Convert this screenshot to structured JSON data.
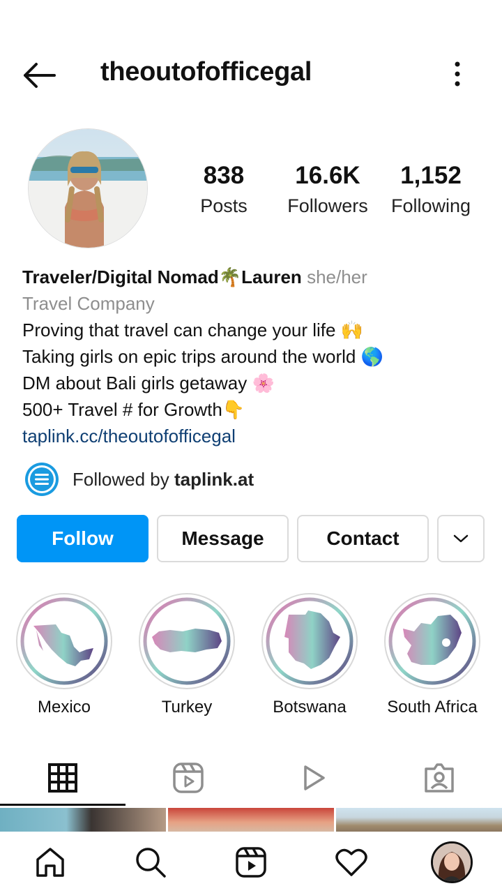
{
  "header": {
    "username": "theoutofofficegal",
    "back_icon": "arrow-left-icon",
    "more_icon": "more-vertical-icon"
  },
  "stats": [
    {
      "value": "838",
      "label": "Posts"
    },
    {
      "value": "16.6K",
      "label": "Followers"
    },
    {
      "value": "1,152",
      "label": "Following"
    }
  ],
  "bio": {
    "name": "Traveler/Digital Nomad🌴Lauren",
    "pronouns": "she/her",
    "category": "Travel Company",
    "lines": [
      "Proving that travel can change your life 🙌",
      "Taking girls on epic trips around the world 🌎",
      "DM about Bali girls getaway 🌸",
      "500+ Travel # for Growth👇"
    ],
    "link": "taplink.cc/theoutofofficegal"
  },
  "followed_by": {
    "prefix": "Followed by ",
    "account": "taplink.at"
  },
  "actions": {
    "follow_label": "Follow",
    "message_label": "Message",
    "contact_label": "Contact"
  },
  "highlights": [
    {
      "label": "Mexico"
    },
    {
      "label": "Turkey"
    },
    {
      "label": "Botswana"
    },
    {
      "label": "South Africa"
    }
  ],
  "tabs": [
    {
      "icon": "grid-icon",
      "active": true
    },
    {
      "icon": "reels-icon",
      "active": false
    },
    {
      "icon": "play-icon",
      "active": false
    },
    {
      "icon": "tagged-icon",
      "active": false
    }
  ],
  "bottom_nav": [
    "home-icon",
    "search-icon",
    "reels-icon",
    "heart-icon",
    "profile-avatar"
  ],
  "colors": {
    "follow_blue": "#0095f6",
    "link_blue": "#0f3f73",
    "gray_text": "#8e8e8e"
  }
}
